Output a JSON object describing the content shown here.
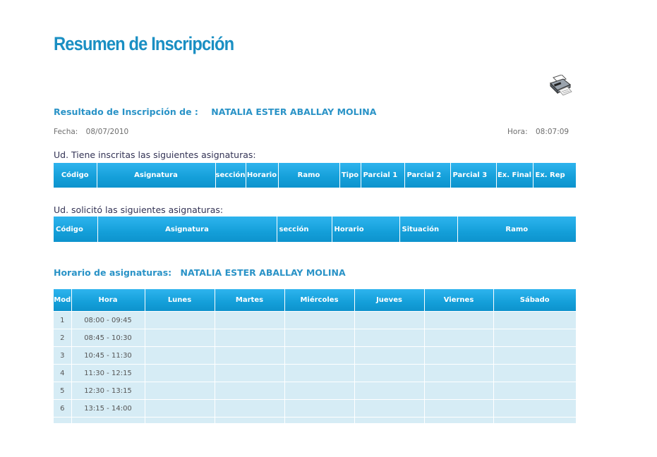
{
  "page": {
    "title": "Resumen de Inscripción"
  },
  "print": {
    "icon": "printer-icon"
  },
  "result": {
    "label": "Resultado de Inscripción de :",
    "student_name": "NATALIA ESTER ABALLAY MOLINA",
    "date_label": "Fecha:",
    "date_value": "08/07/2010",
    "time_label": "Hora:",
    "time_value": "08:07:09"
  },
  "enrolled": {
    "heading": "Ud. Tiene inscritas las siguientes asignaturas:",
    "columns": [
      "Código",
      "Asignatura",
      "sección",
      "Horario",
      "Ramo",
      "Tipo",
      "Parcial 1",
      "Parcial 2",
      "Parcial 3",
      "Ex. Final",
      "Ex. Rep"
    ]
  },
  "requested": {
    "heading": "Ud. solicitó las siguientes asignaturas:",
    "columns": [
      "Código",
      "Asignatura",
      "sección",
      "Horario",
      "Situación",
      "Ramo"
    ]
  },
  "schedule": {
    "heading": "Horario de asignaturas:",
    "student_name": "NATALIA ESTER ABALLAY MOLINA",
    "columns": [
      "Mod",
      "Hora",
      "Lunes",
      "Martes",
      "Miércoles",
      "Jueves",
      "Viernes",
      "Sábado"
    ],
    "rows": [
      {
        "mod": "1",
        "hora": "08:00 - 09:45"
      },
      {
        "mod": "2",
        "hora": "08:45 - 10:30"
      },
      {
        "mod": "3",
        "hora": "10:45 - 11:30"
      },
      {
        "mod": "4",
        "hora": "11:30 - 12:15"
      },
      {
        "mod": "5",
        "hora": "12:30 - 13:15"
      },
      {
        "mod": "6",
        "hora": "13:15 - 14:00"
      },
      {
        "mod": "",
        "hora": ""
      }
    ]
  },
  "colors": {
    "accent": "#1a8fc3",
    "header_bg": "#149fd9",
    "cell_bg": "#d6ecf5"
  }
}
